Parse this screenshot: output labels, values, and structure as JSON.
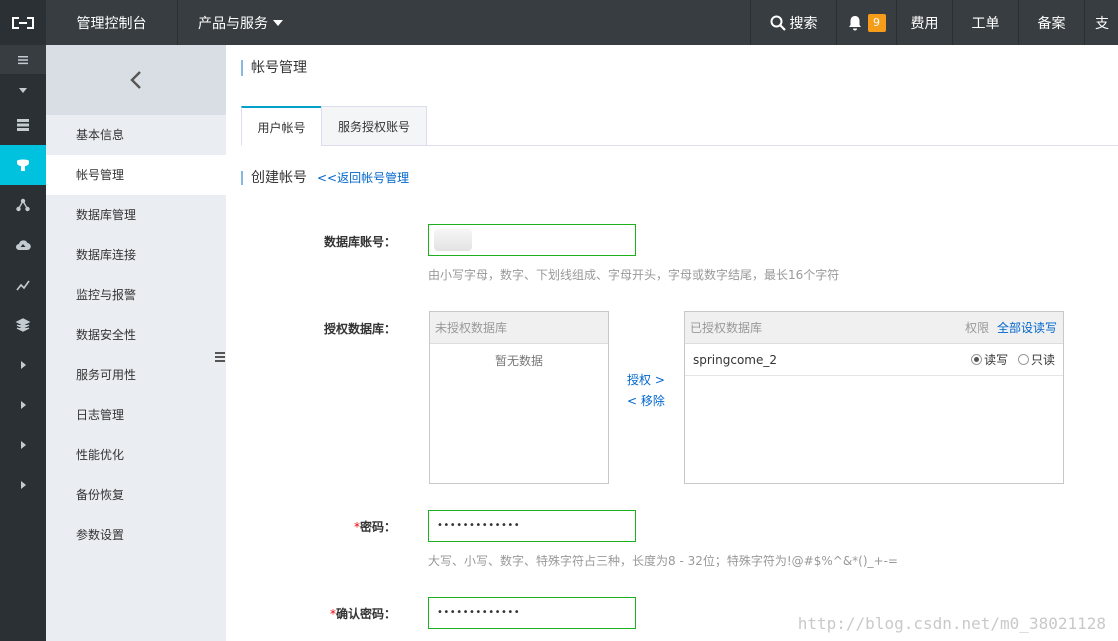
{
  "topbar": {
    "console": "管理控制台",
    "products": "产品与服务",
    "search": "搜索",
    "notification_count": "9",
    "fee": "费用",
    "ticket": "工单",
    "beian": "备案",
    "more": "支"
  },
  "sidebar": {
    "items": [
      {
        "label": "基本信息"
      },
      {
        "label": "帐号管理"
      },
      {
        "label": "数据库管理"
      },
      {
        "label": "数据库连接"
      },
      {
        "label": "监控与报警"
      },
      {
        "label": "数据安全性"
      },
      {
        "label": "服务可用性"
      },
      {
        "label": "日志管理"
      },
      {
        "label": "性能优化"
      },
      {
        "label": "备份恢复"
      },
      {
        "label": "参数设置"
      }
    ]
  },
  "page": {
    "title": "帐号管理",
    "tabs": [
      {
        "label": "用户帐号"
      },
      {
        "label": "服务授权账号"
      }
    ],
    "section_title": "创建帐号",
    "back_link": "<<返回帐号管理"
  },
  "form": {
    "account": {
      "label": "数据库账号：",
      "hint": "由小写字母，数字、下划线组成、字母开头，字母或数字结尾，最长16个字符"
    },
    "authorize": {
      "label": "授权数据库：",
      "unauthorized_header": "未授权数据库",
      "empty_text": "暂无数据",
      "authorize_link": "授权 >",
      "remove_link": "< 移除",
      "authorized_header": "已授权数据库",
      "permission_label": "权限",
      "set_all_link": "全部设读写",
      "rows": [
        {
          "name": "springcome_2",
          "readwrite_label": "读写",
          "readonly_label": "只读",
          "selected": "读写"
        }
      ]
    },
    "password": {
      "required_mark": "*",
      "label": "密码：",
      "value": "•••••••••••••",
      "hint": "大写、小写、数字、特殊字符占三种，长度为8 - 32位；特殊字符为!@#$%^&*()_+-="
    },
    "confirm_password": {
      "required_mark": "*",
      "label": "确认密码：",
      "value": "•••••••••••••"
    }
  },
  "watermark": "http://blog.csdn.net/m0_38021128"
}
